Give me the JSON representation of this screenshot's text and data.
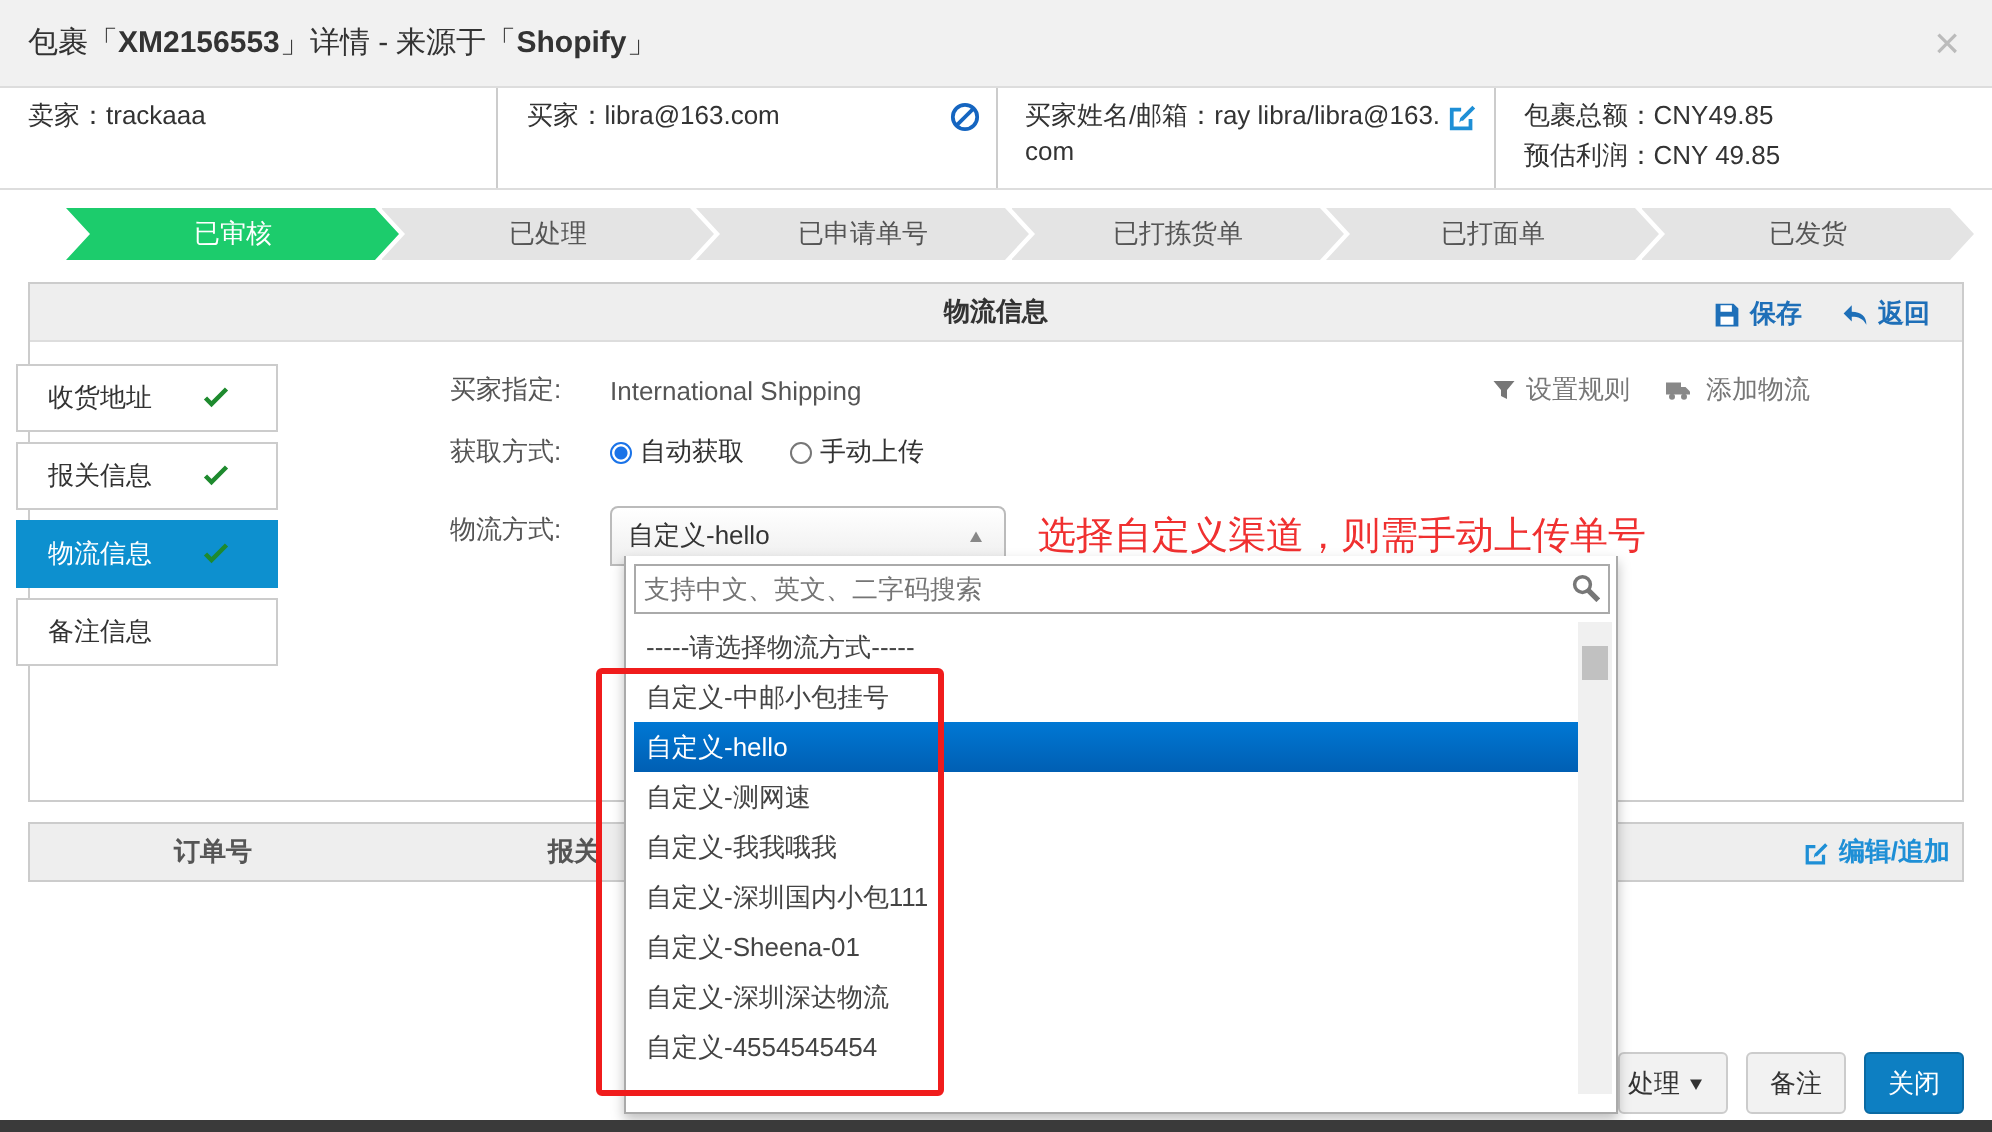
{
  "dialog": {
    "title": "包裹「**XM2156553**」详情 - 来源于「**Shopify**」",
    "close": "×"
  },
  "summary": [
    {
      "kind": "plain",
      "lines": [
        {
          "label": "卖家：",
          "value": "trackaaa"
        }
      ]
    },
    {
      "kind": "block",
      "lines": [
        {
          "label": "买家：",
          "value": "libra@163.com"
        }
      ]
    },
    {
      "kind": "edit",
      "lines": [
        {
          "label": "买家姓名/邮箱：",
          "value": "ray libra/libra@163.com"
        }
      ]
    },
    {
      "kind": "plain",
      "lines": [
        {
          "label": "包裹总额：",
          "value": "CNY49.85"
        },
        {
          "label": "预估利润：",
          "value": "CNY 49.85"
        }
      ]
    }
  ],
  "steps": [
    {
      "label": "已审核",
      "selected": true
    },
    {
      "label": "已处理",
      "selected": false
    },
    {
      "label": "已申请单号",
      "selected": false
    },
    {
      "label": "已打拣货单",
      "selected": false
    },
    {
      "label": "已打面单",
      "selected": false
    },
    {
      "label": "已发货",
      "selected": false
    }
  ],
  "panel": {
    "title": "物流信息",
    "actions": [
      {
        "kind": "save",
        "label": "保存"
      },
      {
        "kind": "back",
        "label": "返回"
      }
    ]
  },
  "side_tabs": [
    {
      "label": "收货地址",
      "checked": true,
      "selected": false
    },
    {
      "label": "报关信息",
      "checked": true,
      "selected": false
    },
    {
      "label": "物流信息",
      "checked": true,
      "selected": true
    },
    {
      "label": "备注信息",
      "checked": false,
      "selected": false
    }
  ],
  "form": {
    "buyer_specified": {
      "label": "买家指定:",
      "value": "International Shipping"
    },
    "tools": [
      {
        "kind": "filter",
        "label": "设置规则"
      },
      {
        "kind": "truck",
        "label": "添加物流"
      }
    ],
    "fetch_method": {
      "label": "获取方式:",
      "options": [
        {
          "label": "自动获取",
          "selected": true
        },
        {
          "label": "手动上传",
          "selected": false
        }
      ]
    },
    "shipping_method": {
      "label": "物流方式:",
      "value": "自定义-hello"
    }
  },
  "dropdown": {
    "placeholder": "支持中文、英文、二字码搜索",
    "options": [
      {
        "label": "-----请选择物流方式-----",
        "selected": false
      },
      {
        "label": "自定义-中邮小包挂号",
        "selected": false
      },
      {
        "label": "自定义-hello",
        "selected": true
      },
      {
        "label": "自定义-测网速",
        "selected": false
      },
      {
        "label": "自定义-我我哦我",
        "selected": false
      },
      {
        "label": "自定义-深圳国内小包111",
        "selected": false
      },
      {
        "label": "自定义-Sheena-01",
        "selected": false
      },
      {
        "label": "自定义-深圳深达物流",
        "selected": false
      },
      {
        "label": "自定义-4554545454",
        "selected": false
      }
    ]
  },
  "annotation": {
    "text": "选择自定义渠道，则需手动上传单号"
  },
  "table": {
    "columns": [
      "订单号",
      "报关"
    ],
    "action": "编辑/追加"
  },
  "buttons": [
    {
      "kind": "menu",
      "label": "处理"
    },
    {
      "kind": "default",
      "label": "备注"
    },
    {
      "kind": "primary",
      "label": "关闭"
    }
  ]
}
